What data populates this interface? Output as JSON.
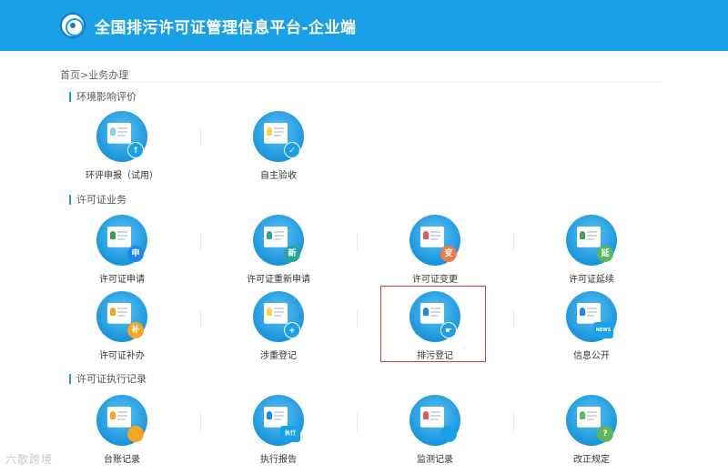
{
  "header": {
    "title": "全国排污许可证管理信息平台-企业端"
  },
  "breadcrumb": "首页>业务办理",
  "sections": [
    {
      "title": "环境影响评价",
      "items": [
        {
          "label": "环评申报（试用）",
          "icon": "document-upload-icon",
          "badge_text": "↑",
          "badge_color": "#1aa0e6"
        },
        {
          "label": "自主验收",
          "icon": "checklist-approve-icon",
          "badge_text": "✓",
          "badge_color": "#1aa0e6"
        }
      ]
    },
    {
      "title": "许可证业务",
      "items": [
        {
          "label": "许可证申请",
          "icon": "license-apply-icon",
          "badge_text": "申",
          "badge_color": "#1e88e5"
        },
        {
          "label": "许可证重新申请",
          "icon": "license-reapply-icon",
          "badge_text": "新",
          "badge_color": "#26a69a"
        },
        {
          "label": "许可证变更",
          "icon": "license-change-icon",
          "badge_text": "变",
          "badge_color": "#f07b4a"
        },
        {
          "label": "许可证延续",
          "icon": "license-renew-icon",
          "badge_text": "延",
          "badge_color": "#5cb85c"
        },
        {
          "label": "许可证补办",
          "icon": "license-reissue-icon",
          "badge_text": "补",
          "badge_color": "#f5a623"
        },
        {
          "label": "涉重登记",
          "icon": "clipboard-add-icon",
          "badge_text": "+",
          "badge_color": "#1aa0e6"
        },
        {
          "label": "排污登记",
          "icon": "id-card-hand-icon",
          "badge_text": "☛",
          "badge_color": "#1aa0e6"
        },
        {
          "label": "信息公开",
          "icon": "news-publish-icon",
          "badge_text": "NEWS",
          "badge_color": "#1aa0e6"
        }
      ]
    },
    {
      "title": "许可证执行记录",
      "items": [
        {
          "label": "台账记录",
          "icon": "ledger-icon",
          "badge_text": "",
          "badge_color": "#f5a623"
        },
        {
          "label": "执行报告",
          "icon": "execution-report-icon",
          "badge_text": "执行",
          "badge_color": "#1aa0e6"
        },
        {
          "label": "监测记录",
          "icon": "monitor-chart-icon",
          "badge_text": "",
          "badge_color": "#1aa0e6"
        },
        {
          "label": "改正规定",
          "icon": "question-doc-icon",
          "badge_text": "?",
          "badge_color": "#5cb85c"
        }
      ]
    }
  ],
  "watermark": "六散跨境"
}
